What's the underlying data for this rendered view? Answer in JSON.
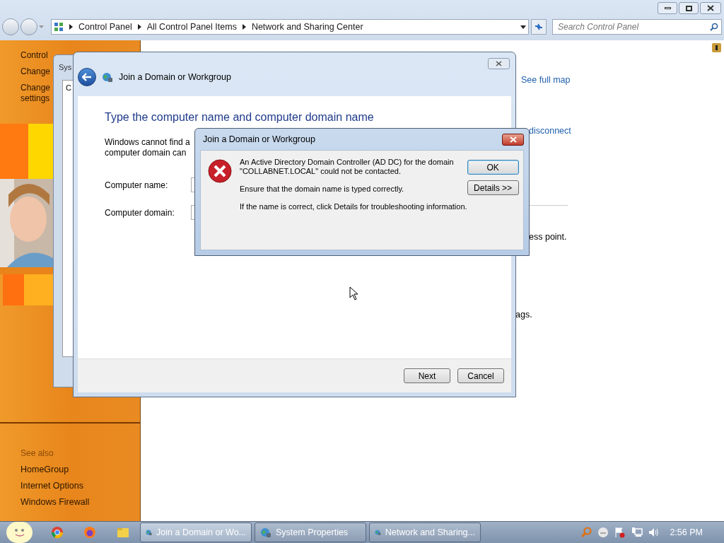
{
  "explorer": {
    "address_path": [
      "Control Panel",
      "All Control Panel Items",
      "Network and Sharing Center"
    ],
    "search": {
      "placeholder": "Search Control Panel"
    },
    "sidebar": {
      "items": [
        {
          "lines": [
            "Control"
          ]
        },
        {
          "lines": [
            "Change"
          ]
        },
        {
          "lines": [
            "Change",
            "settings"
          ]
        }
      ],
      "see_also": {
        "title": "See also",
        "items": [
          "HomeGroup",
          "Internet Options",
          "Windows Firewall"
        ]
      }
    },
    "content": {
      "links": [
        "See full map",
        "disconnect"
      ],
      "texts": [
        "ess point.",
        "ags."
      ]
    }
  },
  "system_properties": {
    "title": "Sys",
    "tab": "C"
  },
  "join_dialog": {
    "title": "Join a Domain or Workgroup",
    "heading": "Type the computer name and computer domain name",
    "text_lines": [
      "Windows cannot find a",
      "computer domain can"
    ],
    "fields": [
      {
        "label": "Computer name:"
      },
      {
        "label": "Computer domain:"
      }
    ],
    "buttons": [
      "Next",
      "Cancel"
    ]
  },
  "error_dialog": {
    "title": "Join a Domain or Workgroup",
    "message": [
      {
        "lines": [
          "An Active Directory Domain Controller (AD DC) for the domain",
          "\"COLLABNET.LOCAL\" could not be contacted."
        ]
      },
      {
        "lines": [
          "Ensure that the domain name is typed correctly."
        ]
      },
      {
        "lines": [
          "If the name is correct, click Details for troubleshooting information."
        ]
      }
    ],
    "buttons": [
      {
        "label": "OK",
        "default": true
      },
      {
        "label": "Details >>",
        "default": false
      }
    ]
  },
  "taskbar": {
    "tasks": [
      {
        "label": "Join a Domain or Wo...",
        "active": true
      },
      {
        "label": "System Properties",
        "active": false
      },
      {
        "label": "Network and Sharing...",
        "active": false
      }
    ],
    "clock": "2:56 PM"
  }
}
